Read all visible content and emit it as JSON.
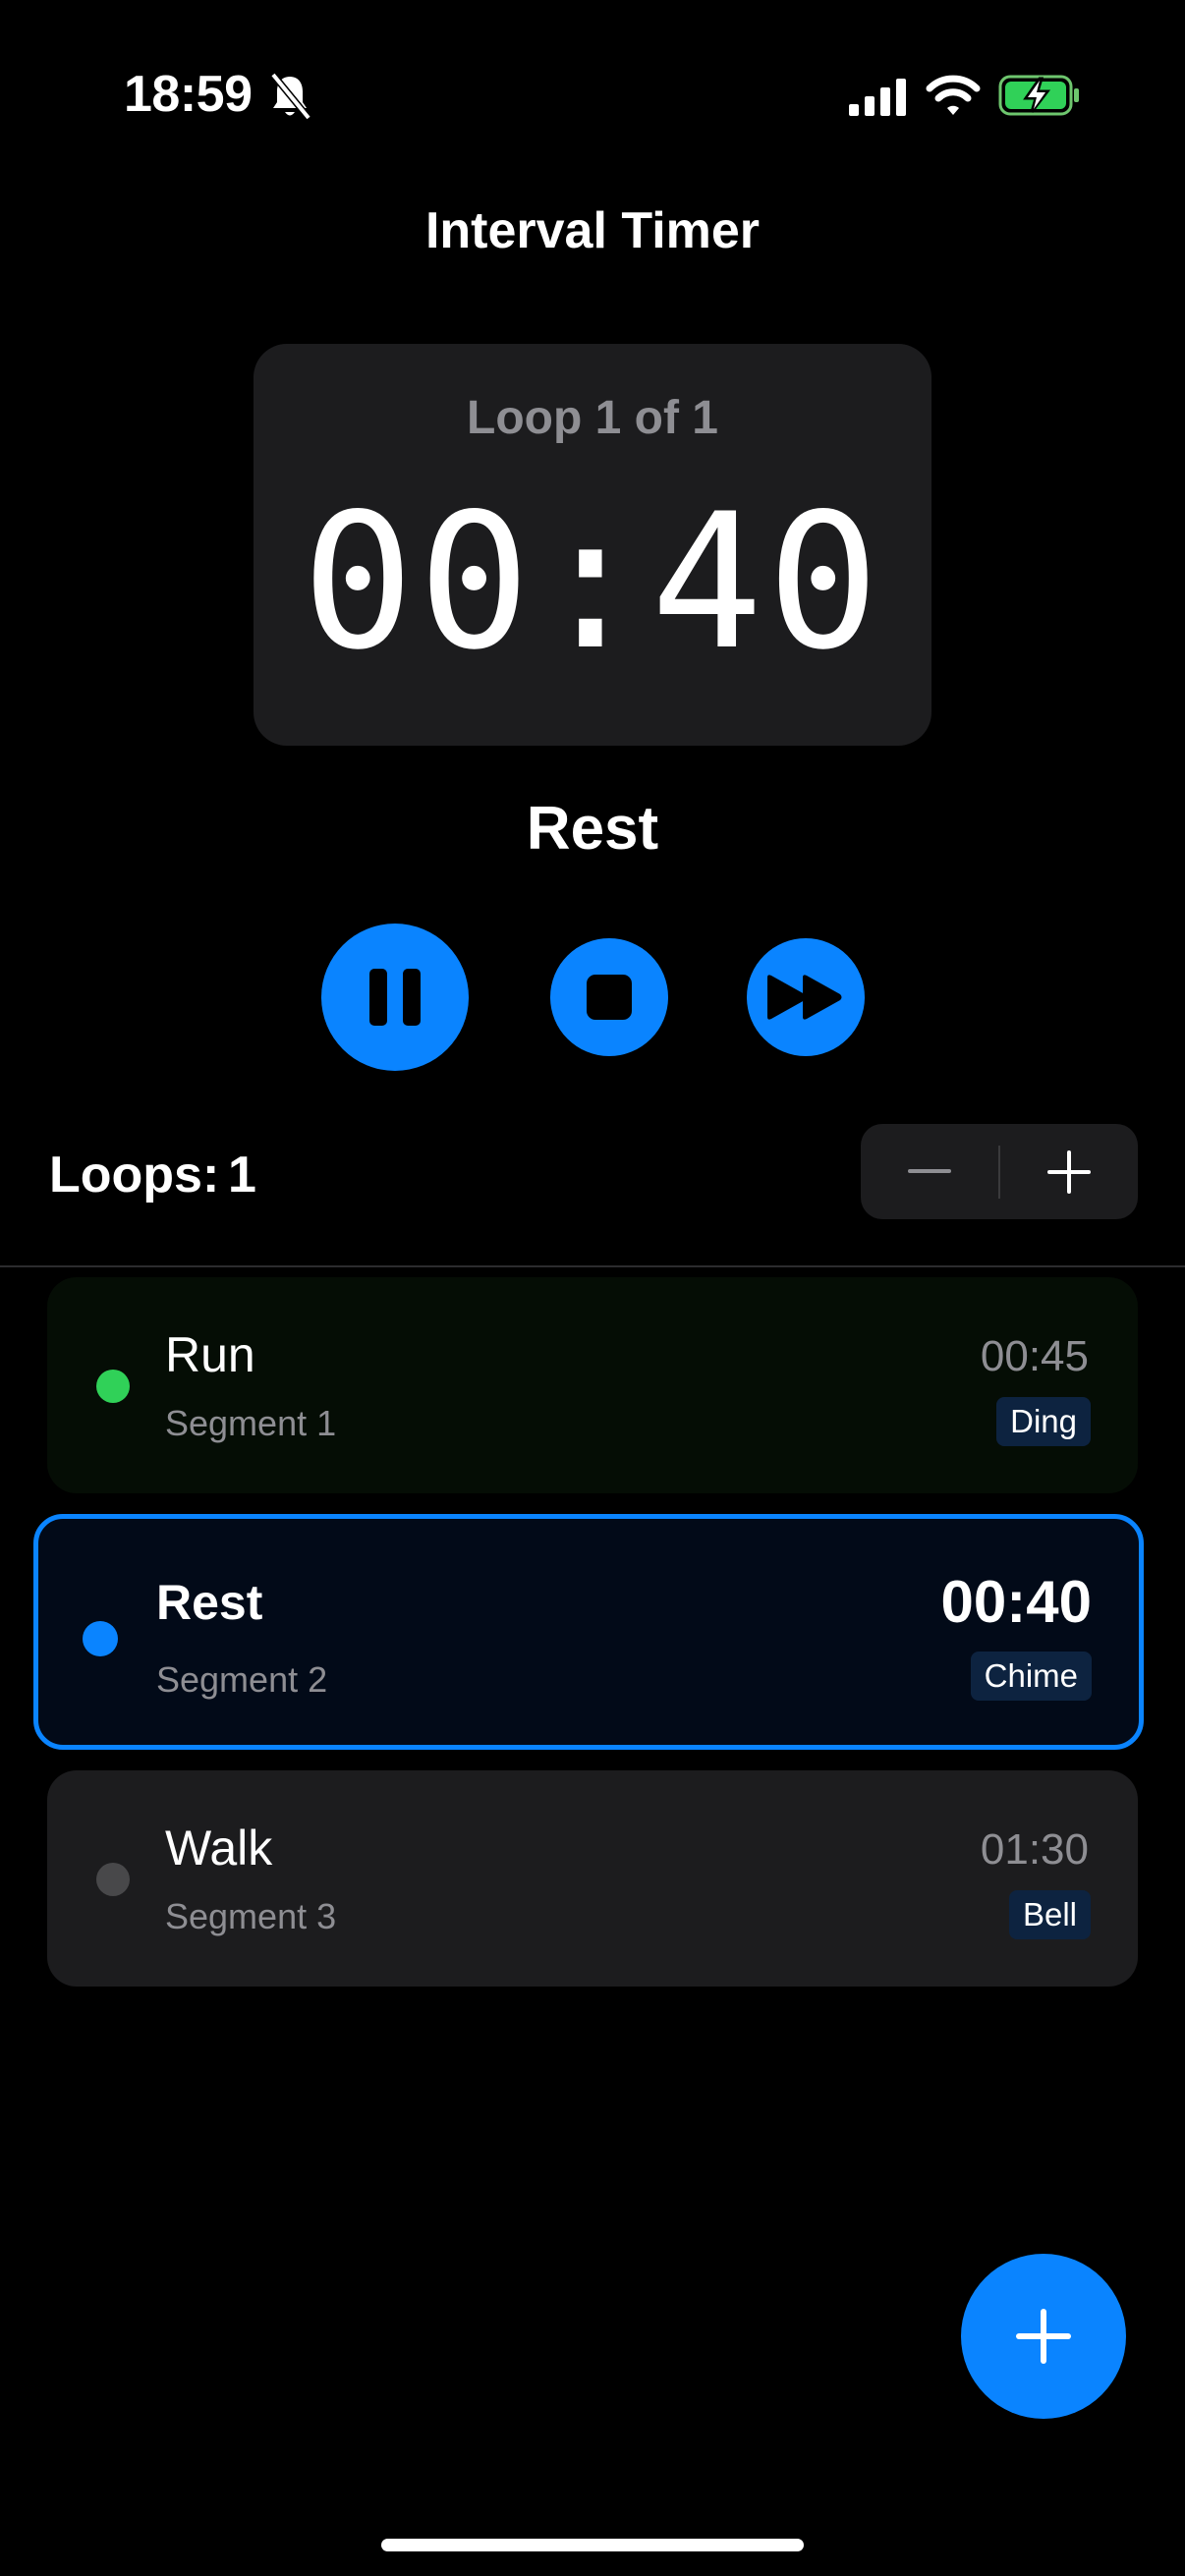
{
  "status_bar": {
    "time": "18:59",
    "icons": [
      "bell-slash-icon",
      "signal-icon",
      "wifi-icon",
      "battery-charging-icon"
    ]
  },
  "app_title": "Interval Timer",
  "timer": {
    "loop_label": "Loop 1 of 1",
    "time": "00:40",
    "current_segment": "Rest"
  },
  "controls": {
    "icons": [
      "pause-icon",
      "stop-icon",
      "skip-forward-icon"
    ]
  },
  "loops": {
    "label": "Loops:",
    "value": "1",
    "stepper_icons": [
      "minus-icon",
      "plus-icon"
    ]
  },
  "segments": [
    {
      "name": "Run",
      "subtitle": "Segment 1",
      "time": "00:45",
      "sound": "Ding",
      "dot_color": "#30d158",
      "state": "completed"
    },
    {
      "name": "Rest",
      "subtitle": "Segment 2",
      "time": "00:40",
      "sound": "Chime",
      "dot_color": "#0a84ff",
      "state": "active"
    },
    {
      "name": "Walk",
      "subtitle": "Segment 3",
      "time": "01:30",
      "sound": "Bell",
      "dot_color": "#48484a",
      "state": "pending"
    }
  ],
  "fab": {
    "icon": "plus-icon"
  },
  "colors": {
    "accent": "#0a84ff",
    "background": "#000000",
    "card": "#1c1c1e",
    "secondary_text": "#8e8e93"
  }
}
